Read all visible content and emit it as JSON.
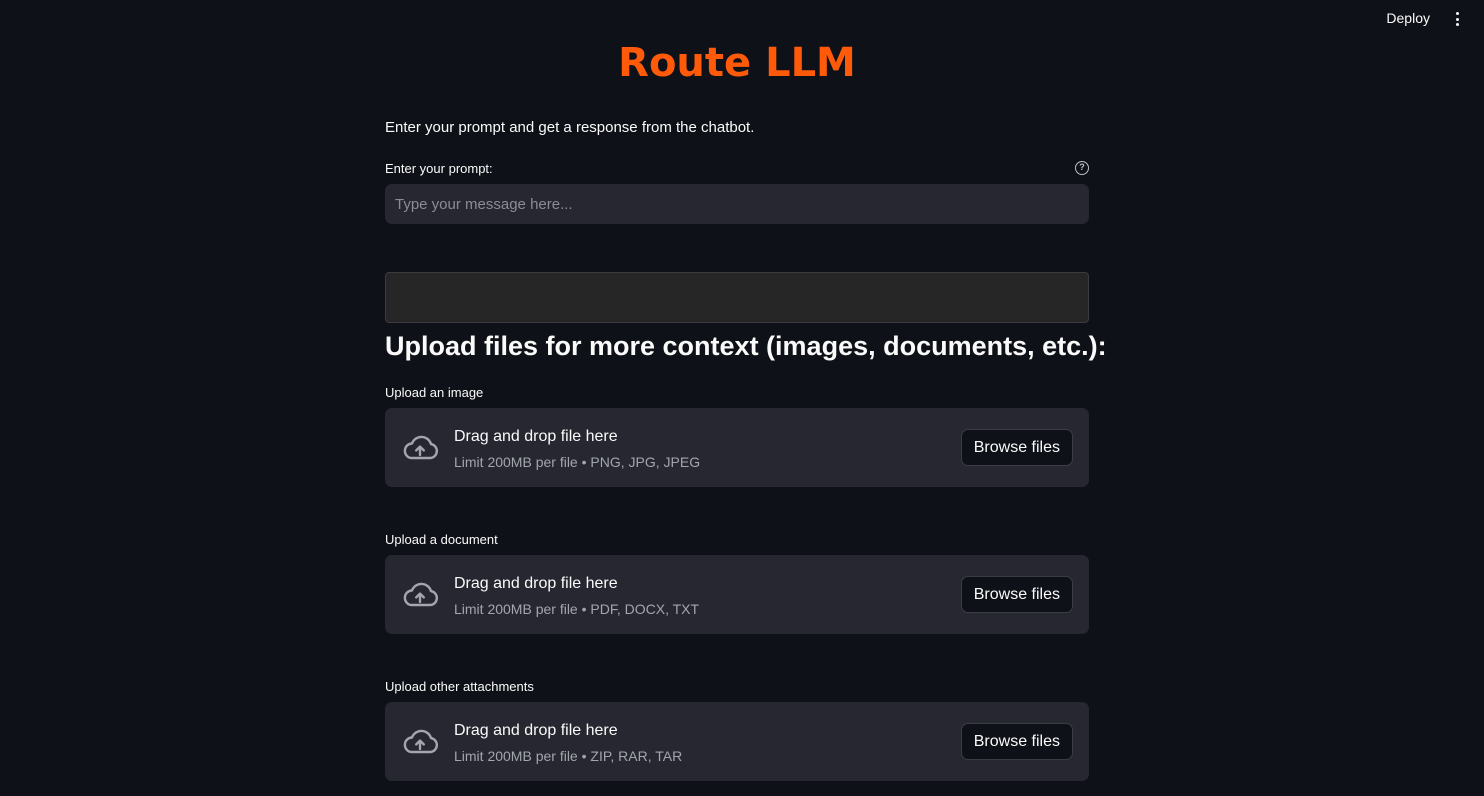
{
  "topbar": {
    "deploy_label": "Deploy",
    "menu_icon": "kebab-menu-icon"
  },
  "title": "Route LLM",
  "intro": "Enter your prompt and get a response from the chatbot.",
  "prompt": {
    "label": "Enter your prompt:",
    "placeholder": "Type your message here...",
    "value": "",
    "help_icon": "?"
  },
  "response": {
    "text": ""
  },
  "upload_heading": "Upload files for more context (images, documents, etc.):",
  "uploaders": [
    {
      "label": "Upload an image",
      "title": "Drag and drop file here",
      "subtitle": "Limit 200MB per file • PNG, JPG, JPEG",
      "button": "Browse files"
    },
    {
      "label": "Upload a document",
      "title": "Drag and drop file here",
      "subtitle": "Limit 200MB per file • PDF, DOCX, TXT",
      "button": "Browse files"
    },
    {
      "label": "Upload other attachments",
      "title": "Drag and drop file here",
      "subtitle": "Limit 200MB per file • ZIP, RAR, TAR",
      "button": "Browse files"
    }
  ],
  "colors": {
    "background": "#0e1117",
    "accent": "#ff5a0a",
    "surface": "#262730"
  }
}
